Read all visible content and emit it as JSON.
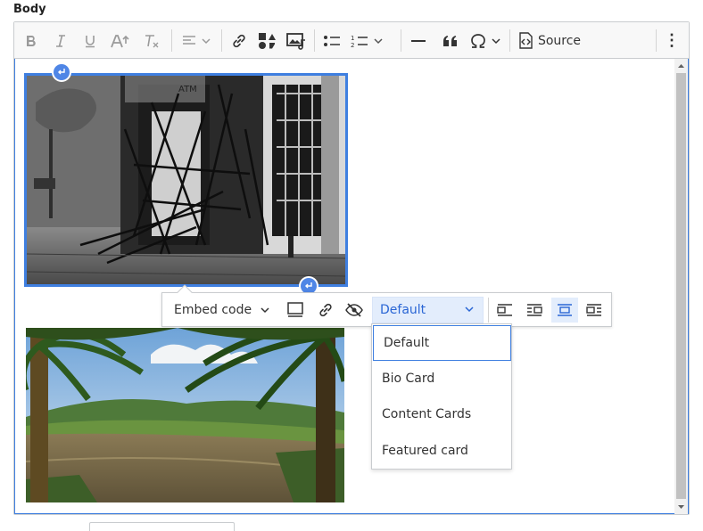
{
  "field": {
    "label": "Body"
  },
  "toolbar": {
    "items": [
      {
        "name": "bold-button",
        "icon": "bold-icon",
        "disabled": true
      },
      {
        "name": "italic-button",
        "icon": "italic-icon",
        "disabled": true
      },
      {
        "name": "underline-button",
        "icon": "underline-icon",
        "disabled": true
      },
      {
        "name": "font-size-button",
        "icon": "font-size-icon",
        "disabled": true
      },
      {
        "name": "remove-format-button",
        "icon": "remove-format-icon",
        "disabled": true
      },
      {
        "name": "align-dropdown",
        "icon": "align-left-icon",
        "disabled": true
      },
      {
        "name": "link-button",
        "icon": "link-icon"
      },
      {
        "name": "insert-media-button",
        "icon": "media-icon"
      },
      {
        "name": "media-library-button",
        "icon": "media-library-icon"
      },
      {
        "name": "bulleted-list-button",
        "icon": "bulleted-list-icon"
      },
      {
        "name": "numbered-list-dropdown",
        "icon": "numbered-list-icon"
      },
      {
        "name": "horizontal-line-button",
        "icon": "horizontal-line-icon"
      },
      {
        "name": "blockquote-button",
        "icon": "quote-icon"
      },
      {
        "name": "special-characters-dropdown",
        "icon": "omega-icon"
      }
    ],
    "source_label": "Source",
    "more_label": "⋮"
  },
  "image_toolbar": {
    "embed_label": "Embed code",
    "style_selected": "Default",
    "style_options": [
      "Default",
      "Bio Card",
      "Content Cards",
      "Featured card"
    ],
    "alignment_options": [
      "align-left",
      "wrap-right",
      "break-text",
      "wrap-left"
    ],
    "active_alignment": "break-text"
  },
  "images": [
    {
      "name": "storefront-photo",
      "selected": true
    },
    {
      "name": "river-palms-photo",
      "selected": false
    }
  ],
  "colors": {
    "accent": "#3f7fe0",
    "selected_bg": "#e3edfc",
    "selected_text": "#2a66d5"
  }
}
